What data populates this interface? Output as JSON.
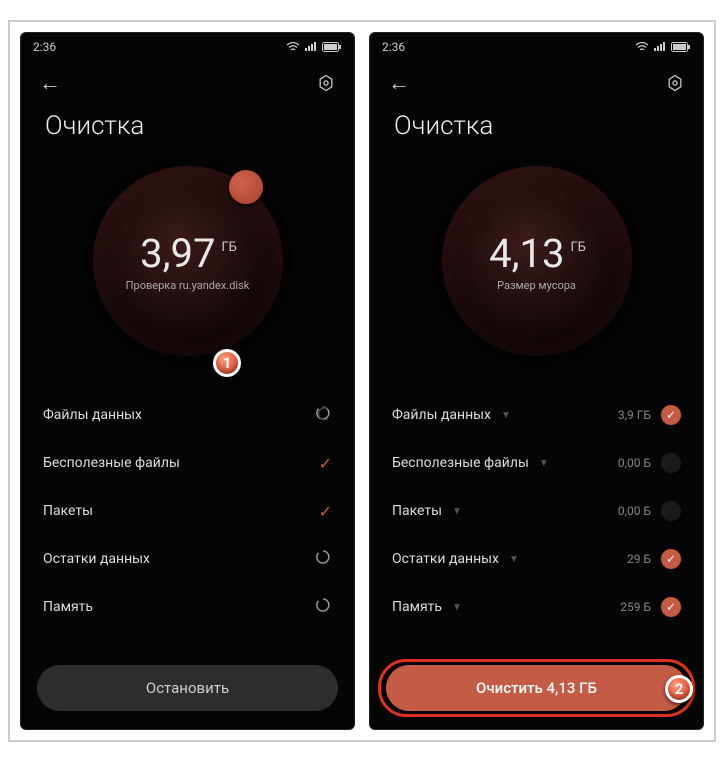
{
  "status": {
    "time": "2:36"
  },
  "title": "Очистка",
  "left": {
    "size": "3,97",
    "unit": "ГБ",
    "subtitle": "Проверка ru.yandex.disk",
    "rows": [
      {
        "label": "Файлы данных",
        "state": "scanning"
      },
      {
        "label": "Бесполезные файлы",
        "state": "done"
      },
      {
        "label": "Пакеты",
        "state": "done"
      },
      {
        "label": "Остатки данных",
        "state": "scanning"
      },
      {
        "label": "Память",
        "state": "scanning"
      }
    ],
    "button": "Остановить"
  },
  "right": {
    "size": "4,13",
    "unit": "ГБ",
    "subtitle": "Размер мусора",
    "rows": [
      {
        "label": "Файлы данных",
        "value": "3,9 ГБ",
        "checked": true
      },
      {
        "label": "Бесполезные файлы",
        "value": "0,00 Б",
        "checked": false
      },
      {
        "label": "Пакеты",
        "value": "0,00 Б",
        "checked": false
      },
      {
        "label": "Остатки данных",
        "value": "29 Б",
        "checked": true
      },
      {
        "label": "Память",
        "value": "259 Б",
        "checked": true
      }
    ],
    "button": "Очистить 4,13 ГБ"
  },
  "markers": {
    "one": "1",
    "two": "2"
  }
}
